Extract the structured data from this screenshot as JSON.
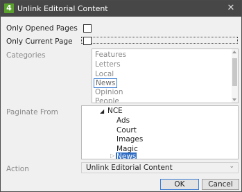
{
  "window": {
    "title": "Unlink Editorial Content",
    "app_icon_text": "4"
  },
  "options": {
    "only_opened_pages": {
      "label": "Only Opened Pages",
      "checked": false
    },
    "only_current_page": {
      "label": "Only Current Page",
      "checked": false
    }
  },
  "categories": {
    "label": "Categories",
    "items": [
      "Features",
      "Letters",
      "Local",
      "News",
      "Opinion",
      "People"
    ],
    "selected": "News"
  },
  "paginate_from": {
    "label": "Paginate From",
    "root": "NCE",
    "children": [
      "Ads",
      "Court",
      "Images",
      "Magic",
      "News"
    ],
    "selected": "News"
  },
  "action": {
    "label": "Action",
    "value": "Unlink Editorial Content"
  },
  "buttons": {
    "ok": "OK",
    "cancel": "Cancel"
  },
  "colors": {
    "title_bar": "#474747",
    "app_icon": "#5aa02c",
    "selection": "#2f6dc4",
    "focus_border": "#3b7bd3"
  }
}
